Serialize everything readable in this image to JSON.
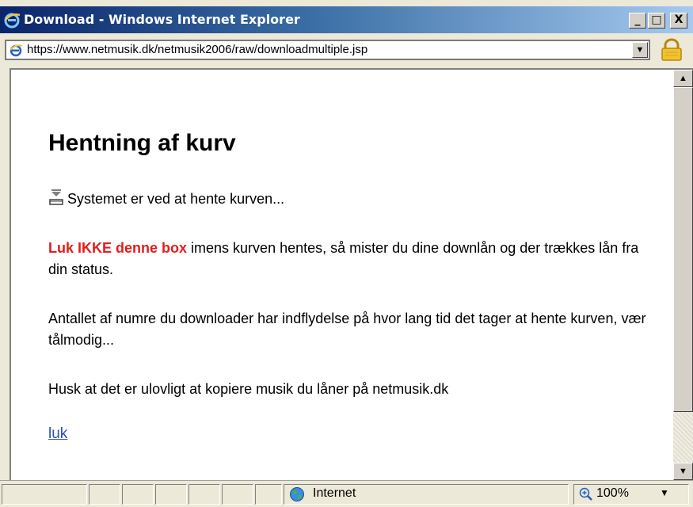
{
  "window": {
    "title": "Download - Windows Internet Explorer",
    "minimize_label": "_",
    "maximize_label": "□",
    "close_label": "X"
  },
  "address": {
    "url": "https://www.netmusik.dk/netmusik2006/raw/downloadmultiple.jsp"
  },
  "page": {
    "title": "Hentning af kurv",
    "status": "Systemet er ved at hente kurven...",
    "warning_bold": "Luk IKKE denne box",
    "warning_rest": " imens kurven hentes, så mister du dine downlån og der trækkes lån fra din status.",
    "info": "Antallet af numre du downloader har indflydelse på hvor lang tid det tager at hente kurven, vær tålmodig...",
    "notice": "Husk at det er ulovligt at kopiere musik du låner på netmusik.dk",
    "close_link": "luk"
  },
  "statusbar": {
    "zone": "Internet",
    "zoom": "100%"
  },
  "colors": {
    "warning": "#e31d1d",
    "link": "#2c4fb0",
    "titlebar_start": "#0a246a"
  }
}
